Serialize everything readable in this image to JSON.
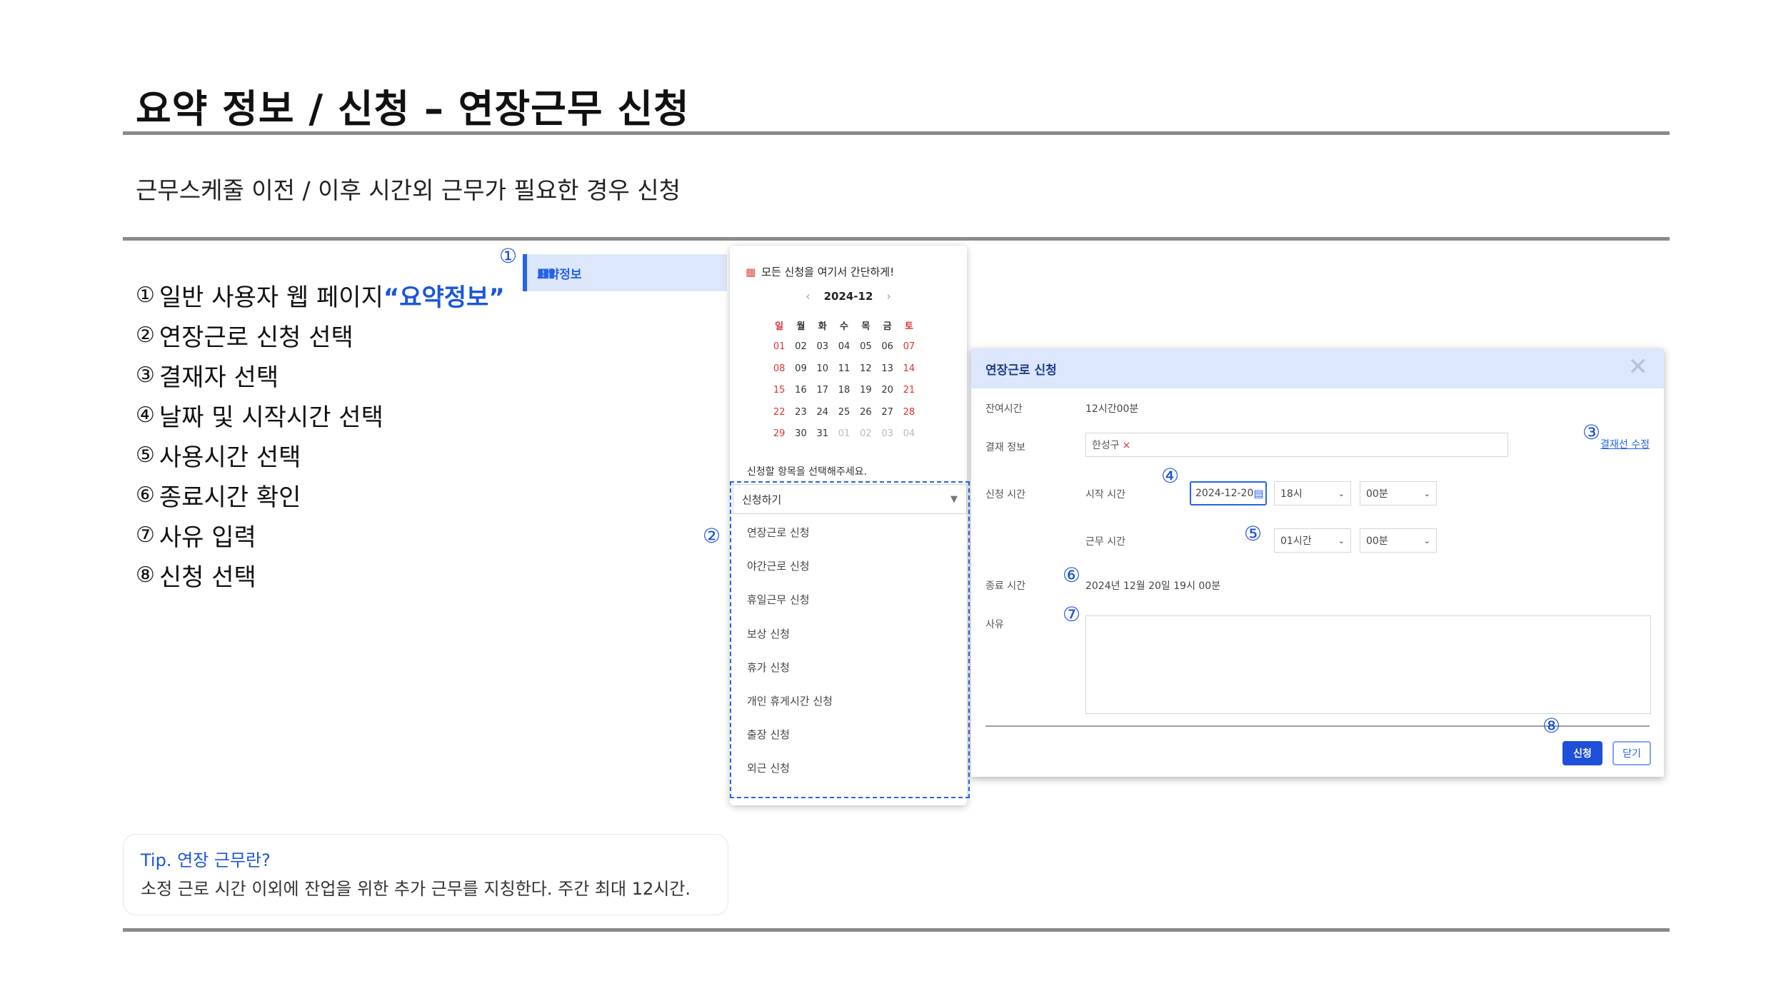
{
  "title": "요약 정보 / 신청 – 연장근무 신청",
  "subtitle": "근무스케줄 이전 / 이후 시간외 근무가 필요한 경우 신청",
  "steps": [
    {
      "num": "①",
      "text": "일반 사용자 웹 페이지 ",
      "highlight": "“요약정보”"
    },
    {
      "num": "②",
      "text": "연장근로 신청 선택"
    },
    {
      "num": "③",
      "text": "결재자 선택"
    },
    {
      "num": "④",
      "text": "날짜 및 시작시간 선택"
    },
    {
      "num": "⑤",
      "text": "사용시간 선택"
    },
    {
      "num": "⑥",
      "text": "종료시간 확인"
    },
    {
      "num": "⑦",
      "text": "사유 입력"
    },
    {
      "num": "⑧",
      "text": "신청 선택"
    }
  ],
  "callouts": {
    "c1": "①",
    "c2": "②",
    "c3": "③",
    "c4": "④",
    "c5": "⑤",
    "c6": "⑥",
    "c7": "⑦",
    "c8": "⑧"
  },
  "sidebar": {
    "item_label": "요약정보",
    "icon": "bar-chart-icon"
  },
  "panel": {
    "header": "모든 신청을 여기서 간단하게!",
    "month": "2024-12",
    "prev": "‹",
    "next": "›",
    "weekdays": [
      "일",
      "월",
      "화",
      "수",
      "목",
      "금",
      "토"
    ],
    "weeks": [
      [
        "01",
        "02",
        "03",
        "04",
        "05",
        "06",
        "07"
      ],
      [
        "08",
        "09",
        "10",
        "11",
        "12",
        "13",
        "14"
      ],
      [
        "15",
        "16",
        "17",
        "18",
        "19",
        "20",
        "21"
      ],
      [
        "22",
        "23",
        "24",
        "25",
        "26",
        "27",
        "28"
      ],
      [
        "29",
        "30",
        "31",
        "01",
        "02",
        "03",
        "04"
      ]
    ],
    "select_prompt": "신청할 항목을 선택해주세요.",
    "select_value": "신청하기",
    "options": [
      "연장근로 신청",
      "야간근로 신청",
      "휴일근무 신청",
      "보상 신청",
      "휴가 신청",
      "개인 휴게시간 신청",
      "출장 신청",
      "외근 신청"
    ]
  },
  "dialog": {
    "title": "연장근로 신청",
    "close": "✕",
    "remaining_label": "잔여시간",
    "remaining_value": "12시간00분",
    "approval_label": "결재 정보",
    "approver": "한성구",
    "approver_remove": "×",
    "edit_approval_line": "결재선 수정",
    "request_time_label": "신청 시간",
    "start_time_label": "시작 시간",
    "start_date": "2024-12-20",
    "start_hour": "18시",
    "start_minute": "00분",
    "work_time_label": "근무 시간",
    "work_hours": "01시간",
    "work_minutes": "00분",
    "end_time_label": "종료 시간",
    "end_time_value": "2024년 12월 20일 19시 00분",
    "reason_label": "사유",
    "reason_value": "",
    "submit": "신청",
    "close_button": "닫기"
  },
  "tip": {
    "title": "Tip. 연장 근무란?",
    "body": "소정 근로 시간 이외에 잔업을 위한 추가 근무를 지칭한다. 주간 최대 12시간."
  },
  "colors": {
    "accent": "#2563eb",
    "sunday_red": "#e03131",
    "header_bg": "#dde7fb"
  }
}
